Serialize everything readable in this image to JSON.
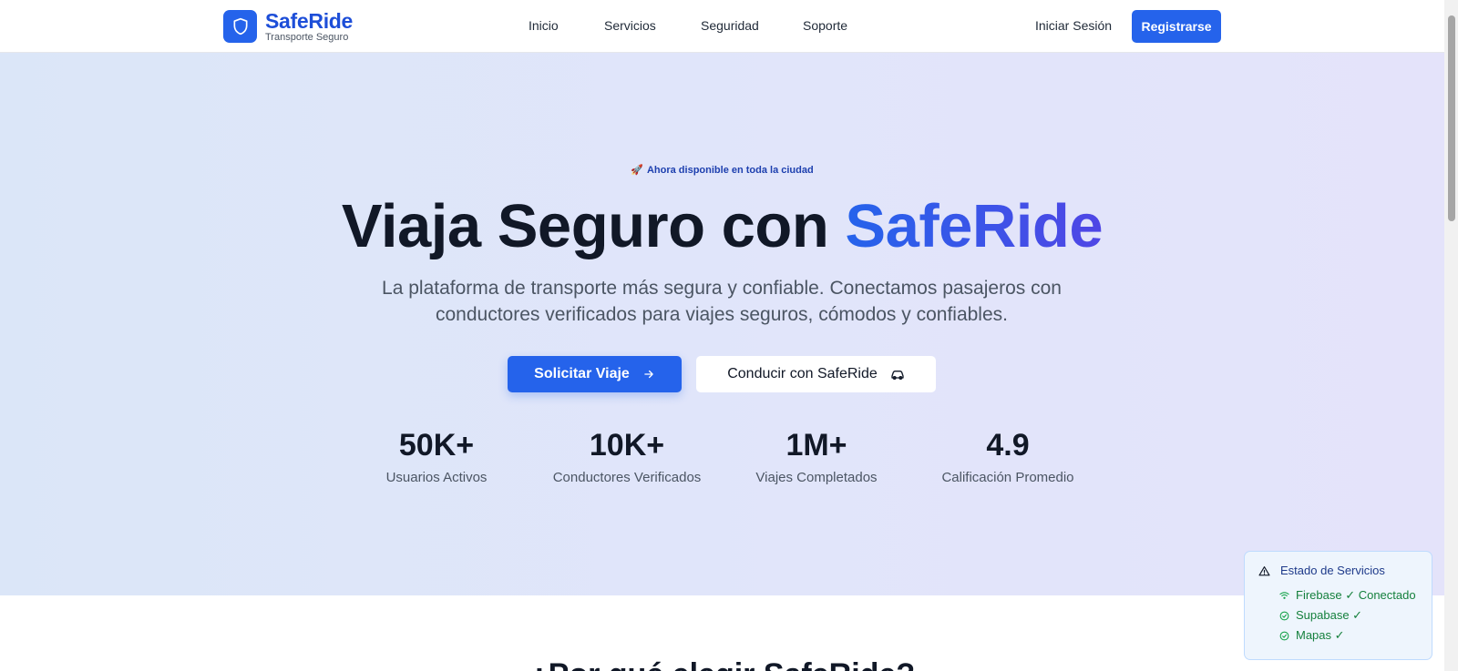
{
  "brand": {
    "name": "SafeRide",
    "tagline": "Transporte Seguro",
    "icon": "shield-icon",
    "color": "#2563eb"
  },
  "nav": {
    "items": [
      {
        "label": "Inicio"
      },
      {
        "label": "Servicios"
      },
      {
        "label": "Seguridad"
      },
      {
        "label": "Soporte"
      }
    ]
  },
  "auth": {
    "login": "Iniciar Sesión",
    "register": "Registrarse"
  },
  "hero": {
    "badge_icon": "rocket-icon",
    "badge": "Ahora disponible en toda la ciudad",
    "title_main": "Viaja Seguro con ",
    "title_accent": "SafeRide",
    "subtitle": "La plataforma de transporte más segura y confiable. Conectamos pasajeros con conductores verificados para viajes seguros, cómodos y confiables.",
    "primary_cta": "Solicitar Viaje",
    "primary_cta_icon": "arrow-right-icon",
    "secondary_cta": "Conducir con SafeRide",
    "secondary_cta_icon": "car-icon"
  },
  "stats": [
    {
      "value": "50K+",
      "label": "Usuarios Activos"
    },
    {
      "value": "10K+",
      "label": "Conductores Verificados"
    },
    {
      "value": "1M+",
      "label": "Viajes Completados"
    },
    {
      "value": "4.9",
      "label": "Calificación Promedio"
    }
  ],
  "next_section": {
    "title": "¿Por qué elegir SafeRide?"
  },
  "service_status": {
    "title": "Estado de Servicios",
    "title_icon": "warning-triangle-icon",
    "items": [
      {
        "label": "Firebase ✓ Conectado",
        "icon": "wifi-icon"
      },
      {
        "label": "Supabase ✓",
        "icon": "check-circle-icon"
      },
      {
        "label": "Mapas ✓",
        "icon": "check-circle-icon"
      }
    ],
    "color": "#15803d"
  }
}
